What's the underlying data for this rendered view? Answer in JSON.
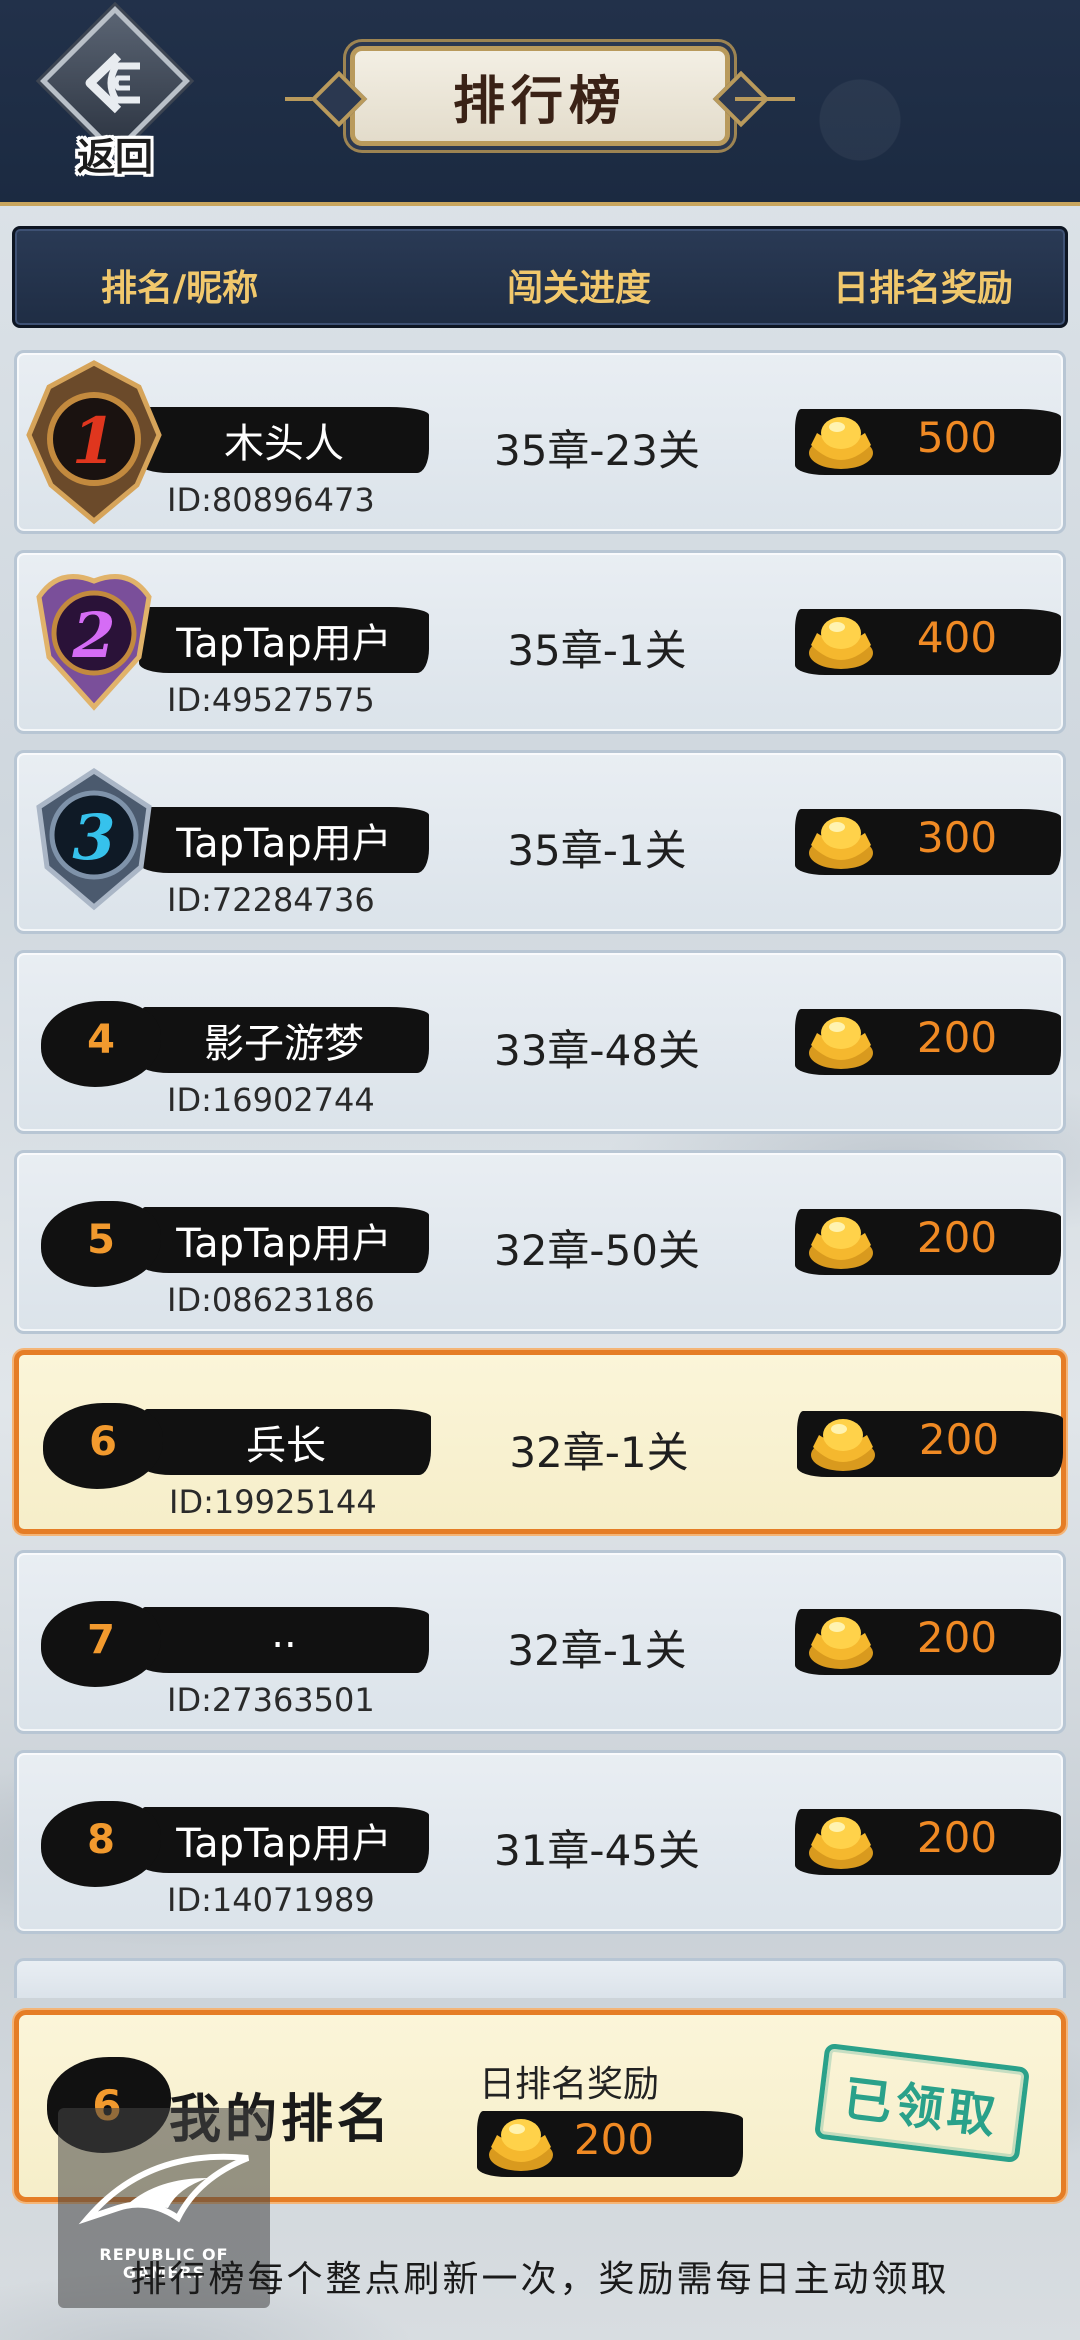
{
  "header": {
    "back_label": "返回",
    "title": "排行榜"
  },
  "columns": {
    "rank_name": "排名/昵称",
    "progress": "闯关进度",
    "reward": "日排名奖励"
  },
  "rows": [
    {
      "rank": "1",
      "name": "木头人",
      "id": "ID:80896473",
      "progress": "35章-23关",
      "reward": "500",
      "medal": "gold-medal-icon"
    },
    {
      "rank": "2",
      "name": "TapTap用户",
      "id": "ID:49527575",
      "progress": "35章-1关",
      "reward": "400",
      "medal": "purple-medal-icon"
    },
    {
      "rank": "3",
      "name": "TapTap用户",
      "id": "ID:72284736",
      "progress": "35章-1关",
      "reward": "300",
      "medal": "blue-medal-icon"
    },
    {
      "rank": "4",
      "name": "影子游梦",
      "id": "ID:16902744",
      "progress": "33章-48关",
      "reward": "200"
    },
    {
      "rank": "5",
      "name": "TapTap用户",
      "id": "ID:08623186",
      "progress": "32章-50关",
      "reward": "200"
    },
    {
      "rank": "6",
      "name": "兵长",
      "id": "ID:19925144",
      "progress": "32章-1关",
      "reward": "200",
      "highlight": true
    },
    {
      "rank": "7",
      "name": "..",
      "id": "ID:27363501",
      "progress": "32章-1关",
      "reward": "200"
    },
    {
      "rank": "8",
      "name": "TapTap用户",
      "id": "ID:14071989",
      "progress": "31章-45关",
      "reward": "200"
    }
  ],
  "my_rank": {
    "rank": "6",
    "label": "我的排名",
    "reward_title": "日排名奖励",
    "reward": "200",
    "status": "已领取"
  },
  "watermark": {
    "line1": "REPUBLIC OF",
    "line2": "GAMERS"
  },
  "footer": "排行榜每个整点刷新一次，奖励需每日主动领取",
  "colors": {
    "header_bg": "#1b2a41",
    "gold_text": "#f1c86c",
    "reward_orange": "#f08a24",
    "highlight_border": "#e57d26",
    "claimed_green": "#2aa18a"
  }
}
